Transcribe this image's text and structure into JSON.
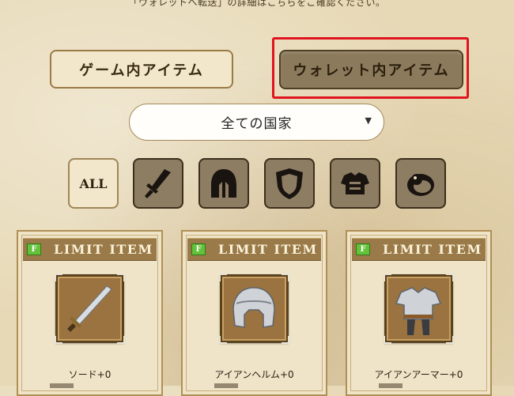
{
  "notice": "「ウォレットへ転送」の詳細はこちらをご確認ください。",
  "tabs": {
    "game": "ゲーム内アイテム",
    "wallet": "ウォレット内アイテム"
  },
  "country_select": {
    "value": "全ての国家"
  },
  "filters": {
    "all": "ALL",
    "icons": [
      "sword-icon",
      "helmet-icon",
      "shield-icon",
      "armor-icon",
      "ring-icon"
    ]
  },
  "cards": [
    {
      "header": "LIMIT ITEM",
      "badge": "F",
      "name": "ソード+0",
      "icon": "sword-item-icon"
    },
    {
      "header": "LIMIT ITEM",
      "badge": "F",
      "name": "アイアンヘルム+0",
      "icon": "helmet-item-icon"
    },
    {
      "header": "LIMIT ITEM",
      "badge": "F",
      "name": "アイアンアーマー+0",
      "icon": "armor-item-icon"
    }
  ],
  "colors": {
    "highlight": "#e0141e",
    "badge": "#64c23a"
  }
}
